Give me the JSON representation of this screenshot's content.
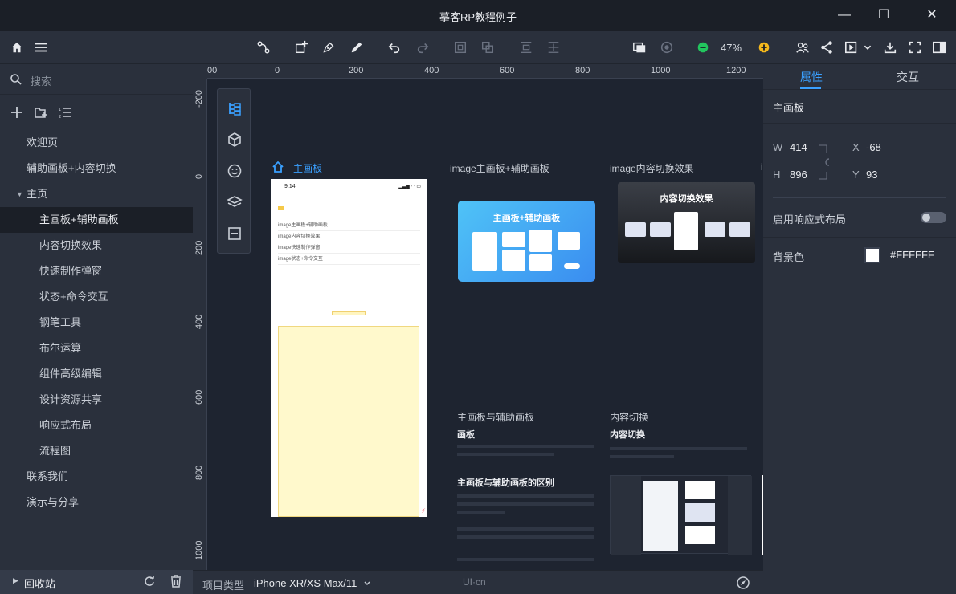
{
  "window": {
    "title": "摹客RP教程例子",
    "minimize": "—",
    "maximize": "☐",
    "close": "✕"
  },
  "toolbar": {
    "icons": [
      "home-icon",
      "menu-icon",
      "connector-icon",
      "add-page-icon",
      "pen-icon",
      "pencil-icon",
      "undo-icon",
      "redo-icon",
      "group-icon",
      "ungroup-icon",
      "align-icon",
      "distribute-icon",
      "preview-frame-icon",
      "target-icon",
      "zoom-out-icon",
      "zoom-in-icon",
      "team-icon",
      "share-icon",
      "play-icon",
      "download-icon",
      "fullscreen-icon",
      "panel-icon"
    ],
    "zoom": "47%",
    "zoom_out_color": "#22c55e",
    "zoom_in_color": "#f5b81c"
  },
  "sidebar": {
    "search_placeholder": "搜索",
    "items": [
      {
        "label": "欢迎页",
        "level": 1
      },
      {
        "label": "辅助画板+内容切换",
        "level": 1
      },
      {
        "label": "主页",
        "level": 1,
        "expanded": true
      },
      {
        "label": "主画板+辅助画板",
        "level": 2,
        "active": true
      },
      {
        "label": "内容切换效果",
        "level": 2
      },
      {
        "label": "快速制作弹窗",
        "level": 2
      },
      {
        "label": "状态+命令交互",
        "level": 2
      },
      {
        "label": "钢笔工具",
        "level": 2
      },
      {
        "label": "布尔运算",
        "level": 2
      },
      {
        "label": "组件高级编辑",
        "level": 2
      },
      {
        "label": "设计资源共享",
        "level": 2
      },
      {
        "label": "响应式布局",
        "level": 2
      },
      {
        "label": "流程图",
        "level": 2
      },
      {
        "label": "联系我们",
        "level": 1
      },
      {
        "label": "演示与分享",
        "level": 1
      }
    ],
    "recycle": "回收站"
  },
  "ruler": {
    "top": [
      "00",
      "0",
      "200",
      "400",
      "600",
      "800",
      "1000",
      "1200"
    ],
    "left": [
      "-200",
      "0",
      "200",
      "400",
      "600",
      "800",
      "1000"
    ]
  },
  "canvas": {
    "main_board_label": "主画板",
    "board2_label": "image主画板+辅助画板",
    "board3_label": "image内容切换效果",
    "board4_label": "i",
    "phone": {
      "time": "9:14",
      "signal": "▂▄▆ ◠ ▭",
      "menu": [
        "image主画板+辅助画板",
        "image内容切换效果",
        "image快速制作弹窗",
        "image状态+命令交互"
      ]
    },
    "thumb1_title": "主画板+辅助画板",
    "thumb2_title": "内容切换效果",
    "doc1": {
      "label": "主画板与辅助画板",
      "heading": "画板",
      "subheading": "主画板与辅助画板的区别"
    },
    "doc2": {
      "label": "内容切换",
      "heading": "内容切换"
    }
  },
  "right_panel": {
    "tabs": [
      "属性",
      "交互"
    ],
    "board_name": "主画板",
    "w_label": "W",
    "w": "414",
    "h_label": "H",
    "h": "896",
    "x_label": "X",
    "x": "-68",
    "y_label": "Y",
    "y": "93",
    "responsive_label": "启用响应式布局",
    "responsive_enabled": false,
    "bg_label": "背景色",
    "bg_value": "#FFFFFF"
  },
  "bottombar": {
    "type_label": "项目类型",
    "type_value": "iPhone XR/XS Max/11",
    "watermark": "UI·cn"
  }
}
